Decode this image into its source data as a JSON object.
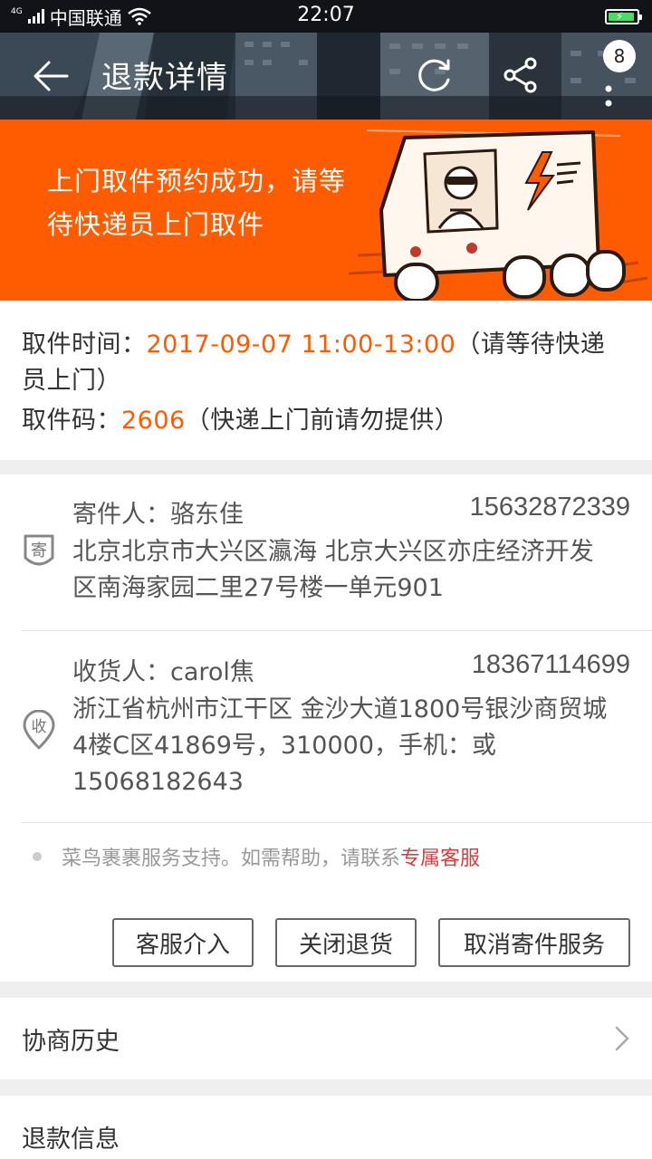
{
  "status_bar": {
    "network": "4G",
    "carrier": "中国联通",
    "time": "22:07"
  },
  "header": {
    "title": "退款详情",
    "badge_count": "8",
    "icons": [
      "back-arrow-icon",
      "refresh-icon",
      "share-icon",
      "more-vertical-icon"
    ]
  },
  "banner": {
    "text": "上门取件预约成功，请等待快递员上门取件",
    "bg_color": "#ff5b00"
  },
  "pickup": {
    "time_label": "取件时间：",
    "time_value": "2017-09-07 11:00-13:00",
    "time_note_1": "（请等待快递",
    "time_note_2": "员上门）",
    "code_label": "取件码：",
    "code_value": "2606",
    "code_note": "（快递上门前请勿提供）"
  },
  "sender": {
    "icon_char": "寄",
    "name": "寄件人：骆东佳",
    "phone": "15632872339",
    "address_line1": "北京北京市大兴区瀛海 北京大兴区亦庄经济开发",
    "address_line2": "区南海家园二里27号楼一单元901"
  },
  "receiver": {
    "icon_char": "收",
    "name": "收货人：carol焦",
    "phone": "18367114699",
    "address_line1": "浙江省杭州市江干区 金沙大道1800号银沙商贸城",
    "address_line2": "4楼C区41869号，310000，手机：或",
    "address_line3": "15068182643"
  },
  "help": {
    "text": "菜鸟裹裹服务支持。如需帮助，请联系",
    "link": "专属客服"
  },
  "actions": {
    "intervene": "客服介入",
    "close_return": "关闭退货",
    "cancel_pickup": "取消寄件服务"
  },
  "sections": {
    "history": "协商历史",
    "refund_info": "退款信息"
  },
  "colors": {
    "accent_orange": "#ff5a00",
    "link_red": "#e4393c"
  }
}
